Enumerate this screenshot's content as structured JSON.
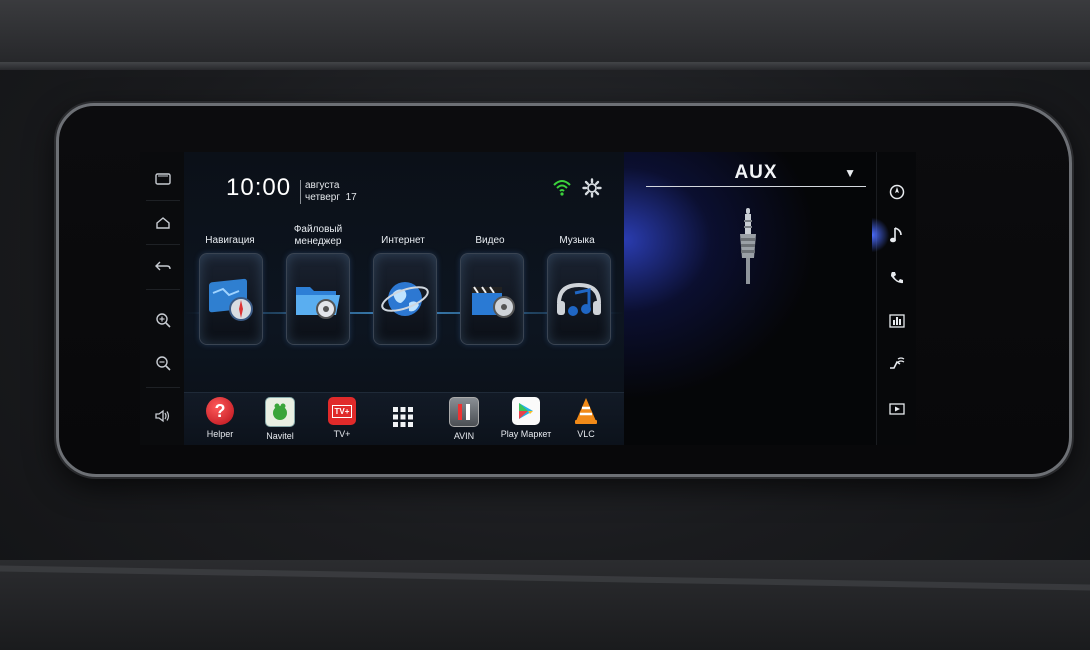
{
  "clock": {
    "time": "10:00",
    "month": "августа",
    "weekday": "четверг",
    "day": "17"
  },
  "status_icons": [
    "wifi-icon",
    "settings-icon"
  ],
  "left_nav": [
    "recent-apps-icon",
    "home-icon",
    "back-icon",
    "zoom-in-icon",
    "zoom-out-icon",
    "volume-icon"
  ],
  "tiles": [
    {
      "label": "Навигация",
      "icon": "navigation-icon"
    },
    {
      "label": "Файловый менеджер",
      "icon": "file-manager-icon"
    },
    {
      "label": "Интернет",
      "icon": "internet-icon"
    },
    {
      "label": "Видео",
      "icon": "video-icon"
    },
    {
      "label": "Музыка",
      "icon": "music-icon"
    }
  ],
  "dock": [
    {
      "label": "Helper",
      "icon": "helper-icon"
    },
    {
      "label": "Navitel",
      "icon": "navitel-icon"
    },
    {
      "label": "TV+",
      "icon": "tv-plus-icon",
      "badge": "TV+"
    },
    {
      "label": "",
      "icon": "app-drawer-icon"
    },
    {
      "label": "AVIN",
      "icon": "avin-icon"
    },
    {
      "label": "Play Маркет",
      "icon": "play-market-icon"
    },
    {
      "label": "VLC",
      "icon": "vlc-icon"
    }
  ],
  "aux": {
    "title": "AUX",
    "dropdown_arrow": "▼"
  },
  "right_nav": [
    "compass-icon",
    "music-note-icon",
    "phone-icon",
    "equalizer-icon",
    "climate-icon",
    "video-player-icon"
  ],
  "colors": {
    "accent_blue": "#2a3cb0",
    "wifi_green": "#3cd23c",
    "glow": "#50b4ff"
  }
}
